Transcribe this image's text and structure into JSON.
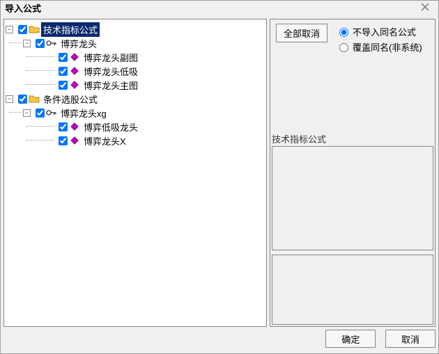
{
  "window": {
    "title": "导入公式"
  },
  "buttons": {
    "deselect_all": "全部取消",
    "ok": "确定",
    "cancel": "取消"
  },
  "options": {
    "skip_same_name": "不导入同名公式",
    "overwrite_same_name": "覆盖同名(非系统)",
    "selected": "skip_same_name"
  },
  "side": {
    "current_category": "技术指标公式"
  },
  "tree": {
    "root1": {
      "label": "技术指标公式",
      "child": {
        "label": "博弈龙头",
        "items": [
          "博弈龙头副图",
          "博弈龙头低吸",
          "博弈龙头主图"
        ]
      }
    },
    "root2": {
      "label": "条件选股公式",
      "child": {
        "label": "博弈龙头xg",
        "items": [
          "博弈低吸龙头",
          "博弈龙头X"
        ]
      }
    }
  }
}
